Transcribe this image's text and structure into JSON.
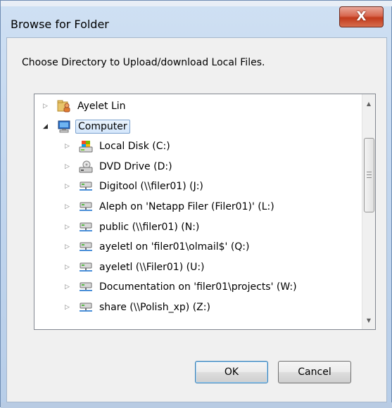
{
  "window": {
    "title": "Browse for Folder",
    "close_glyph": "X"
  },
  "dialog": {
    "description": "Choose Directory to Upload/download Local Files."
  },
  "tree": {
    "items": [
      {
        "label": "Ayelet Lin",
        "icon": "user-folder-icon",
        "expanded": false,
        "selected": false,
        "level": 0
      },
      {
        "label": "Computer",
        "icon": "computer-icon",
        "expanded": true,
        "selected": true,
        "level": 0
      },
      {
        "label": "Local Disk (C:)",
        "icon": "local-disk-icon",
        "expanded": false,
        "selected": false,
        "level": 1
      },
      {
        "label": "DVD Drive (D:)",
        "icon": "dvd-drive-icon",
        "expanded": false,
        "selected": false,
        "level": 1
      },
      {
        "label": "Digitool (\\\\filer01) (J:)",
        "icon": "network-drive-icon",
        "expanded": false,
        "selected": false,
        "level": 1
      },
      {
        "label": "Aleph on 'Netapp Filer (Filer01)' (L:)",
        "icon": "network-drive-icon",
        "expanded": false,
        "selected": false,
        "level": 1
      },
      {
        "label": "public (\\\\filer01) (N:)",
        "icon": "network-drive-icon",
        "expanded": false,
        "selected": false,
        "level": 1
      },
      {
        "label": "ayeletl on 'filer01\\olmail$' (Q:)",
        "icon": "network-drive-icon",
        "expanded": false,
        "selected": false,
        "level": 1
      },
      {
        "label": "ayeletl (\\\\Filer01) (U:)",
        "icon": "network-drive-icon",
        "expanded": false,
        "selected": false,
        "level": 1
      },
      {
        "label": "Documentation on 'filer01\\projects' (W:)",
        "icon": "network-drive-icon",
        "expanded": false,
        "selected": false,
        "level": 1
      },
      {
        "label": "share (\\\\Polish_xp) (Z:)",
        "icon": "network-drive-icon",
        "expanded": false,
        "selected": false,
        "level": 1
      }
    ]
  },
  "buttons": {
    "ok": "OK",
    "cancel": "Cancel"
  },
  "colors": {
    "selection_border": "#7da2ce",
    "close_red": "#c23b1d"
  }
}
